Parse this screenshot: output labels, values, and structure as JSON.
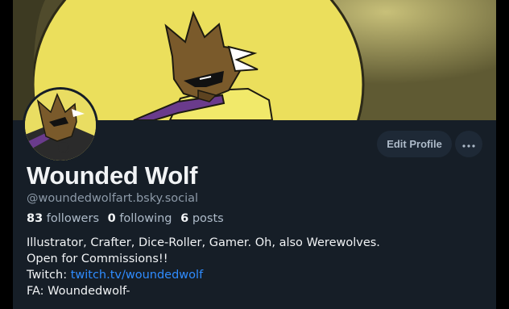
{
  "profile": {
    "display_name": "Wounded Wolf",
    "handle": "@woundedwolfart.bsky.social",
    "stats": {
      "followers_count": "83",
      "followers_label": "followers",
      "following_count": "0",
      "following_label": "following",
      "posts_count": "6",
      "posts_label": "posts"
    },
    "bio": {
      "line1": "Illustrator, Crafter, Dice-Roller, Gamer. Oh, also Werewolves.",
      "line2": "Open for Commissions!!",
      "twitch_prefix": "Twitch: ",
      "twitch_link": "twitch.tv/woundedwolf",
      "line4": "FA: Woundedwolf-"
    }
  },
  "actions": {
    "edit_profile_label": "Edit Profile",
    "more_icon": "ellipsis-icon"
  },
  "colors": {
    "background": "#161e27",
    "button_bg": "#1e2936",
    "link": "#2f8cff",
    "muted_text": "#8d9aa8",
    "banner_yellow": "#e9dd62"
  }
}
